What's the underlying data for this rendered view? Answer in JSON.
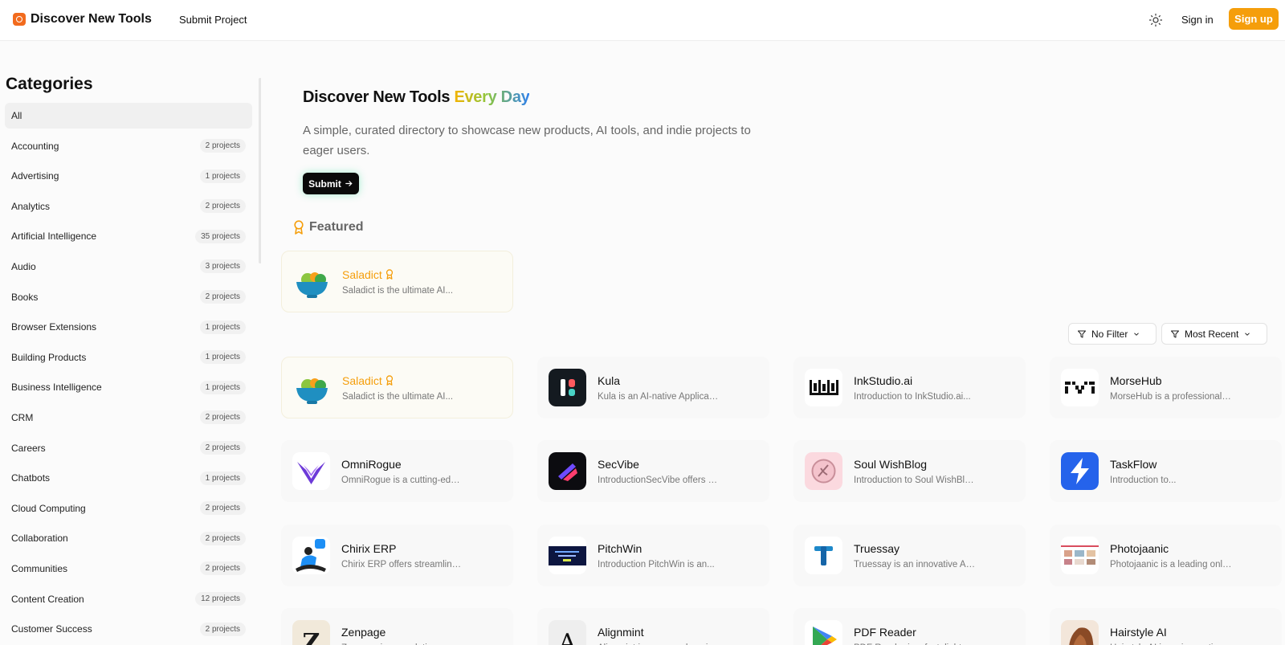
{
  "header": {
    "brand": "Discover New Tools",
    "nav_submit": "Submit Project",
    "sign_in": "Sign in",
    "sign_up": "Sign up",
    "icons": {
      "logo": "logo-icon",
      "theme": "sun-icon"
    }
  },
  "sidebar": {
    "title": "Categories",
    "items": [
      {
        "label": "All",
        "count": ""
      },
      {
        "label": "Accounting",
        "count": "2 projects"
      },
      {
        "label": "Advertising",
        "count": "1 projects"
      },
      {
        "label": "Analytics",
        "count": "2 projects"
      },
      {
        "label": "Artificial Intelligence",
        "count": "35 projects"
      },
      {
        "label": "Audio",
        "count": "3 projects"
      },
      {
        "label": "Books",
        "count": "2 projects"
      },
      {
        "label": "Browser Extensions",
        "count": "1 projects"
      },
      {
        "label": "Building Products",
        "count": "1 projects"
      },
      {
        "label": "Business Intelligence",
        "count": "1 projects"
      },
      {
        "label": "CRM",
        "count": "2 projects"
      },
      {
        "label": "Careers",
        "count": "2 projects"
      },
      {
        "label": "Chatbots",
        "count": "1 projects"
      },
      {
        "label": "Cloud Computing",
        "count": "2 projects"
      },
      {
        "label": "Collaboration",
        "count": "2 projects"
      },
      {
        "label": "Communities",
        "count": "2 projects"
      },
      {
        "label": "Content Creation",
        "count": "12 projects"
      },
      {
        "label": "Customer Success",
        "count": "2 projects"
      }
    ]
  },
  "hero": {
    "title_plain": "Discover New Tools ",
    "title_highlight": "Every Day",
    "description": "A simple, curated directory to showcase new products, AI tools, and indie projects to eager users.",
    "submit": "Submit"
  },
  "featured": {
    "label": "Featured",
    "icon": "award-icon",
    "card": {
      "title": "Saladict",
      "desc": "Saladict is the ultimate AI...",
      "icon": "salad-bowl-icon"
    }
  },
  "filters": {
    "filter": "No Filter",
    "sort": "Most Recent"
  },
  "projects": [
    {
      "title": "Saladict",
      "desc": "Saladict is the ultimate AI...",
      "icon": "salad-bowl-icon",
      "featured": true
    },
    {
      "title": "Kula",
      "desc": "Kula is an AI-native Applicant...",
      "icon": "kula-logo-icon",
      "featured": false
    },
    {
      "title": "InkStudio.ai",
      "desc": "Introduction to InkStudio.ai...",
      "icon": "inkstudio-logo-icon",
      "featured": false
    },
    {
      "title": "MorseHub",
      "desc": "MorseHub is a professional, ad-...",
      "icon": "morsehub-logo-icon",
      "featured": false
    },
    {
      "title": "OmniRogue",
      "desc": "OmniRogue is a cutting-edge, al...",
      "icon": "omnirogue-logo-icon",
      "featured": false
    },
    {
      "title": "SecVibe",
      "desc": "IntroductionSecVibe offers a...",
      "icon": "secvibe-logo-icon",
      "featured": false
    },
    {
      "title": "Soul WishBlog",
      "desc": "Introduction to Soul WishBlog...",
      "icon": "soulwishblog-logo-icon",
      "featured": false
    },
    {
      "title": "TaskFlow",
      "desc": "Introduction to...",
      "icon": "lightning-icon",
      "featured": false
    },
    {
      "title": "Chirix ERP",
      "desc": "Chirix ERP offers streamlined,...",
      "icon": "chirix-illustration-icon",
      "featured": false
    },
    {
      "title": "PitchWin",
      "desc": "Introduction PitchWin is an...",
      "icon": "pitchwin-thumbnail-icon",
      "featured": false
    },
    {
      "title": "Truessay",
      "desc": "Truessay is an innovative AI...",
      "icon": "truessay-logo-icon",
      "featured": false
    },
    {
      "title": "Photojaanic",
      "desc": "Photojaanic is a leading online...",
      "icon": "photojaanic-thumbnail-icon",
      "featured": false
    },
    {
      "title": "Zenpage",
      "desc": "Zenpage is a revolutionary, free-...",
      "icon": "zenpage-logo-icon",
      "featured": false
    },
    {
      "title": "Alignmint",
      "desc": "Alignmint is a comprehensive, al...",
      "icon": "alignmint-logo-icon",
      "featured": false
    },
    {
      "title": "PDF Reader",
      "desc": "PDF Reader is a fast, lightweigh...",
      "icon": "play-store-icon",
      "featured": false
    },
    {
      "title": "Hairstyle AI",
      "desc": "Hairstyle AI is an innovative Saa...",
      "icon": "hairstyle-photo-icon",
      "featured": false
    }
  ]
}
